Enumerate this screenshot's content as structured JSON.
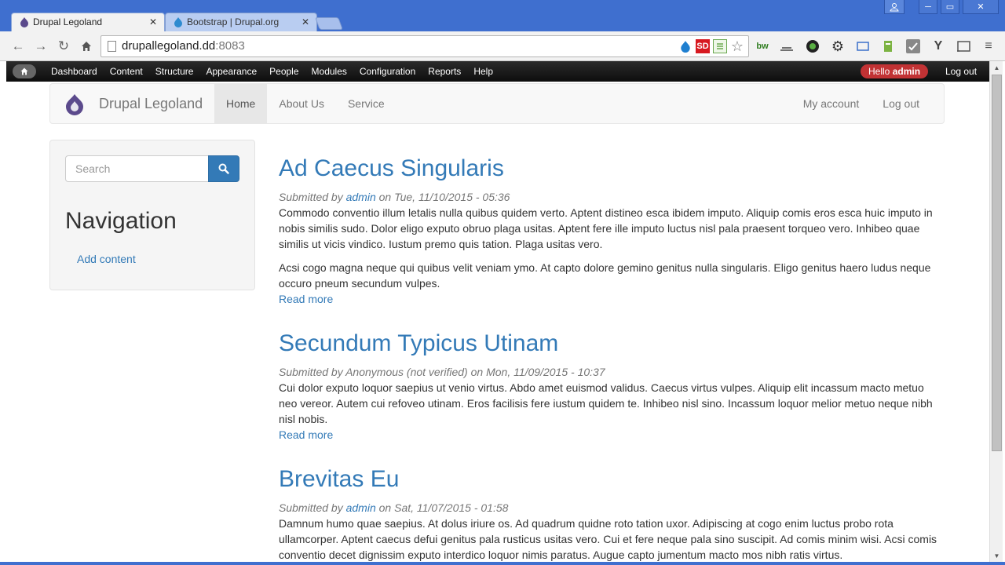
{
  "browser": {
    "tabs": [
      {
        "title": "Drupal Legoland",
        "active": true
      },
      {
        "title": "Bootstrap | Drupal.org",
        "active": false
      }
    ],
    "url_host": "drupallegoland.dd",
    "url_port": ":8083",
    "extensions": [
      "drupal-icon",
      "sd-icon",
      "sheet-icon",
      "star-icon",
      "bw-icon",
      "scale-icon",
      "color-icon",
      "gear-icon",
      "screen-icon",
      "evernote-icon",
      "check-icon",
      "y-icon",
      "cast-icon",
      "menu-icon"
    ],
    "ext_labels": {
      "sd": "SD",
      "bw": "bw",
      "y": "Y"
    }
  },
  "admin_toolbar": {
    "items": [
      "Dashboard",
      "Content",
      "Structure",
      "Appearance",
      "People",
      "Modules",
      "Configuration",
      "Reports",
      "Help"
    ],
    "hello_prefix": "Hello ",
    "hello_user": "admin",
    "logout": "Log out"
  },
  "site": {
    "brand": "Drupal Legoland",
    "main_menu": [
      {
        "label": "Home",
        "active": true
      },
      {
        "label": "About Us",
        "active": false
      },
      {
        "label": "Service",
        "active": false
      }
    ],
    "account_menu": [
      "My account",
      "Log out"
    ]
  },
  "sidebar": {
    "search_placeholder": "Search",
    "heading": "Navigation",
    "link": "Add content"
  },
  "articles": [
    {
      "title": "Ad Caecus Singularis",
      "submitted_by": "Submitted by ",
      "author": "admin",
      "author_is_link": true,
      "date": " on Tue, 11/10/2015 - 05:36",
      "paragraphs": [
        "Commodo conventio illum letalis nulla quibus quidem verto. Aptent distineo esca ibidem imputo. Aliquip comis eros esca huic imputo in nobis similis sudo. Dolor eligo exputo obruo plaga usitas. Aptent fere ille imputo luctus nisl pala praesent torqueo vero. Inhibeo quae similis ut vicis vindico. Iustum premo quis tation. Plaga usitas vero.",
        "Acsi cogo magna neque qui quibus velit veniam ymo. At capto dolore gemino genitus nulla singularis. Eligo genitus haero ludus neque occuro pneum secundum vulpes."
      ],
      "read_more": "Read more"
    },
    {
      "title": "Secundum Typicus Utinam",
      "submitted_by": "Submitted by ",
      "author": "Anonymous (not verified)",
      "author_is_link": false,
      "date": " on Mon, 11/09/2015 - 10:37",
      "paragraphs": [
        "Cui dolor exputo loquor saepius ut venio virtus. Abdo amet euismod validus. Caecus virtus vulpes. Aliquip elit incassum macto metuo neo vereor. Autem cui refoveo utinam. Eros facilisis fere iustum quidem te. Inhibeo nisl sino. Incassum loquor melior metuo neque nibh nisl nobis."
      ],
      "read_more": "Read more"
    },
    {
      "title": "Brevitas Eu",
      "submitted_by": "Submitted by ",
      "author": "admin",
      "author_is_link": true,
      "date": " on Sat, 11/07/2015 - 01:58",
      "paragraphs": [
        "Damnum humo quae saepius. At dolus iriure os. Ad quadrum quidne roto tation uxor. Adipiscing at cogo enim luctus probo rota ullamcorper. Aptent caecus defui genitus pala rusticus usitas vero. Cui et fere neque pala sino suscipit. Ad comis minim wisi. Acsi comis conventio decet dignissim exputo interdico loquor nimis paratus. Augue capto jumentum macto mos nibh ratis virtus."
      ],
      "read_more": ""
    }
  ]
}
